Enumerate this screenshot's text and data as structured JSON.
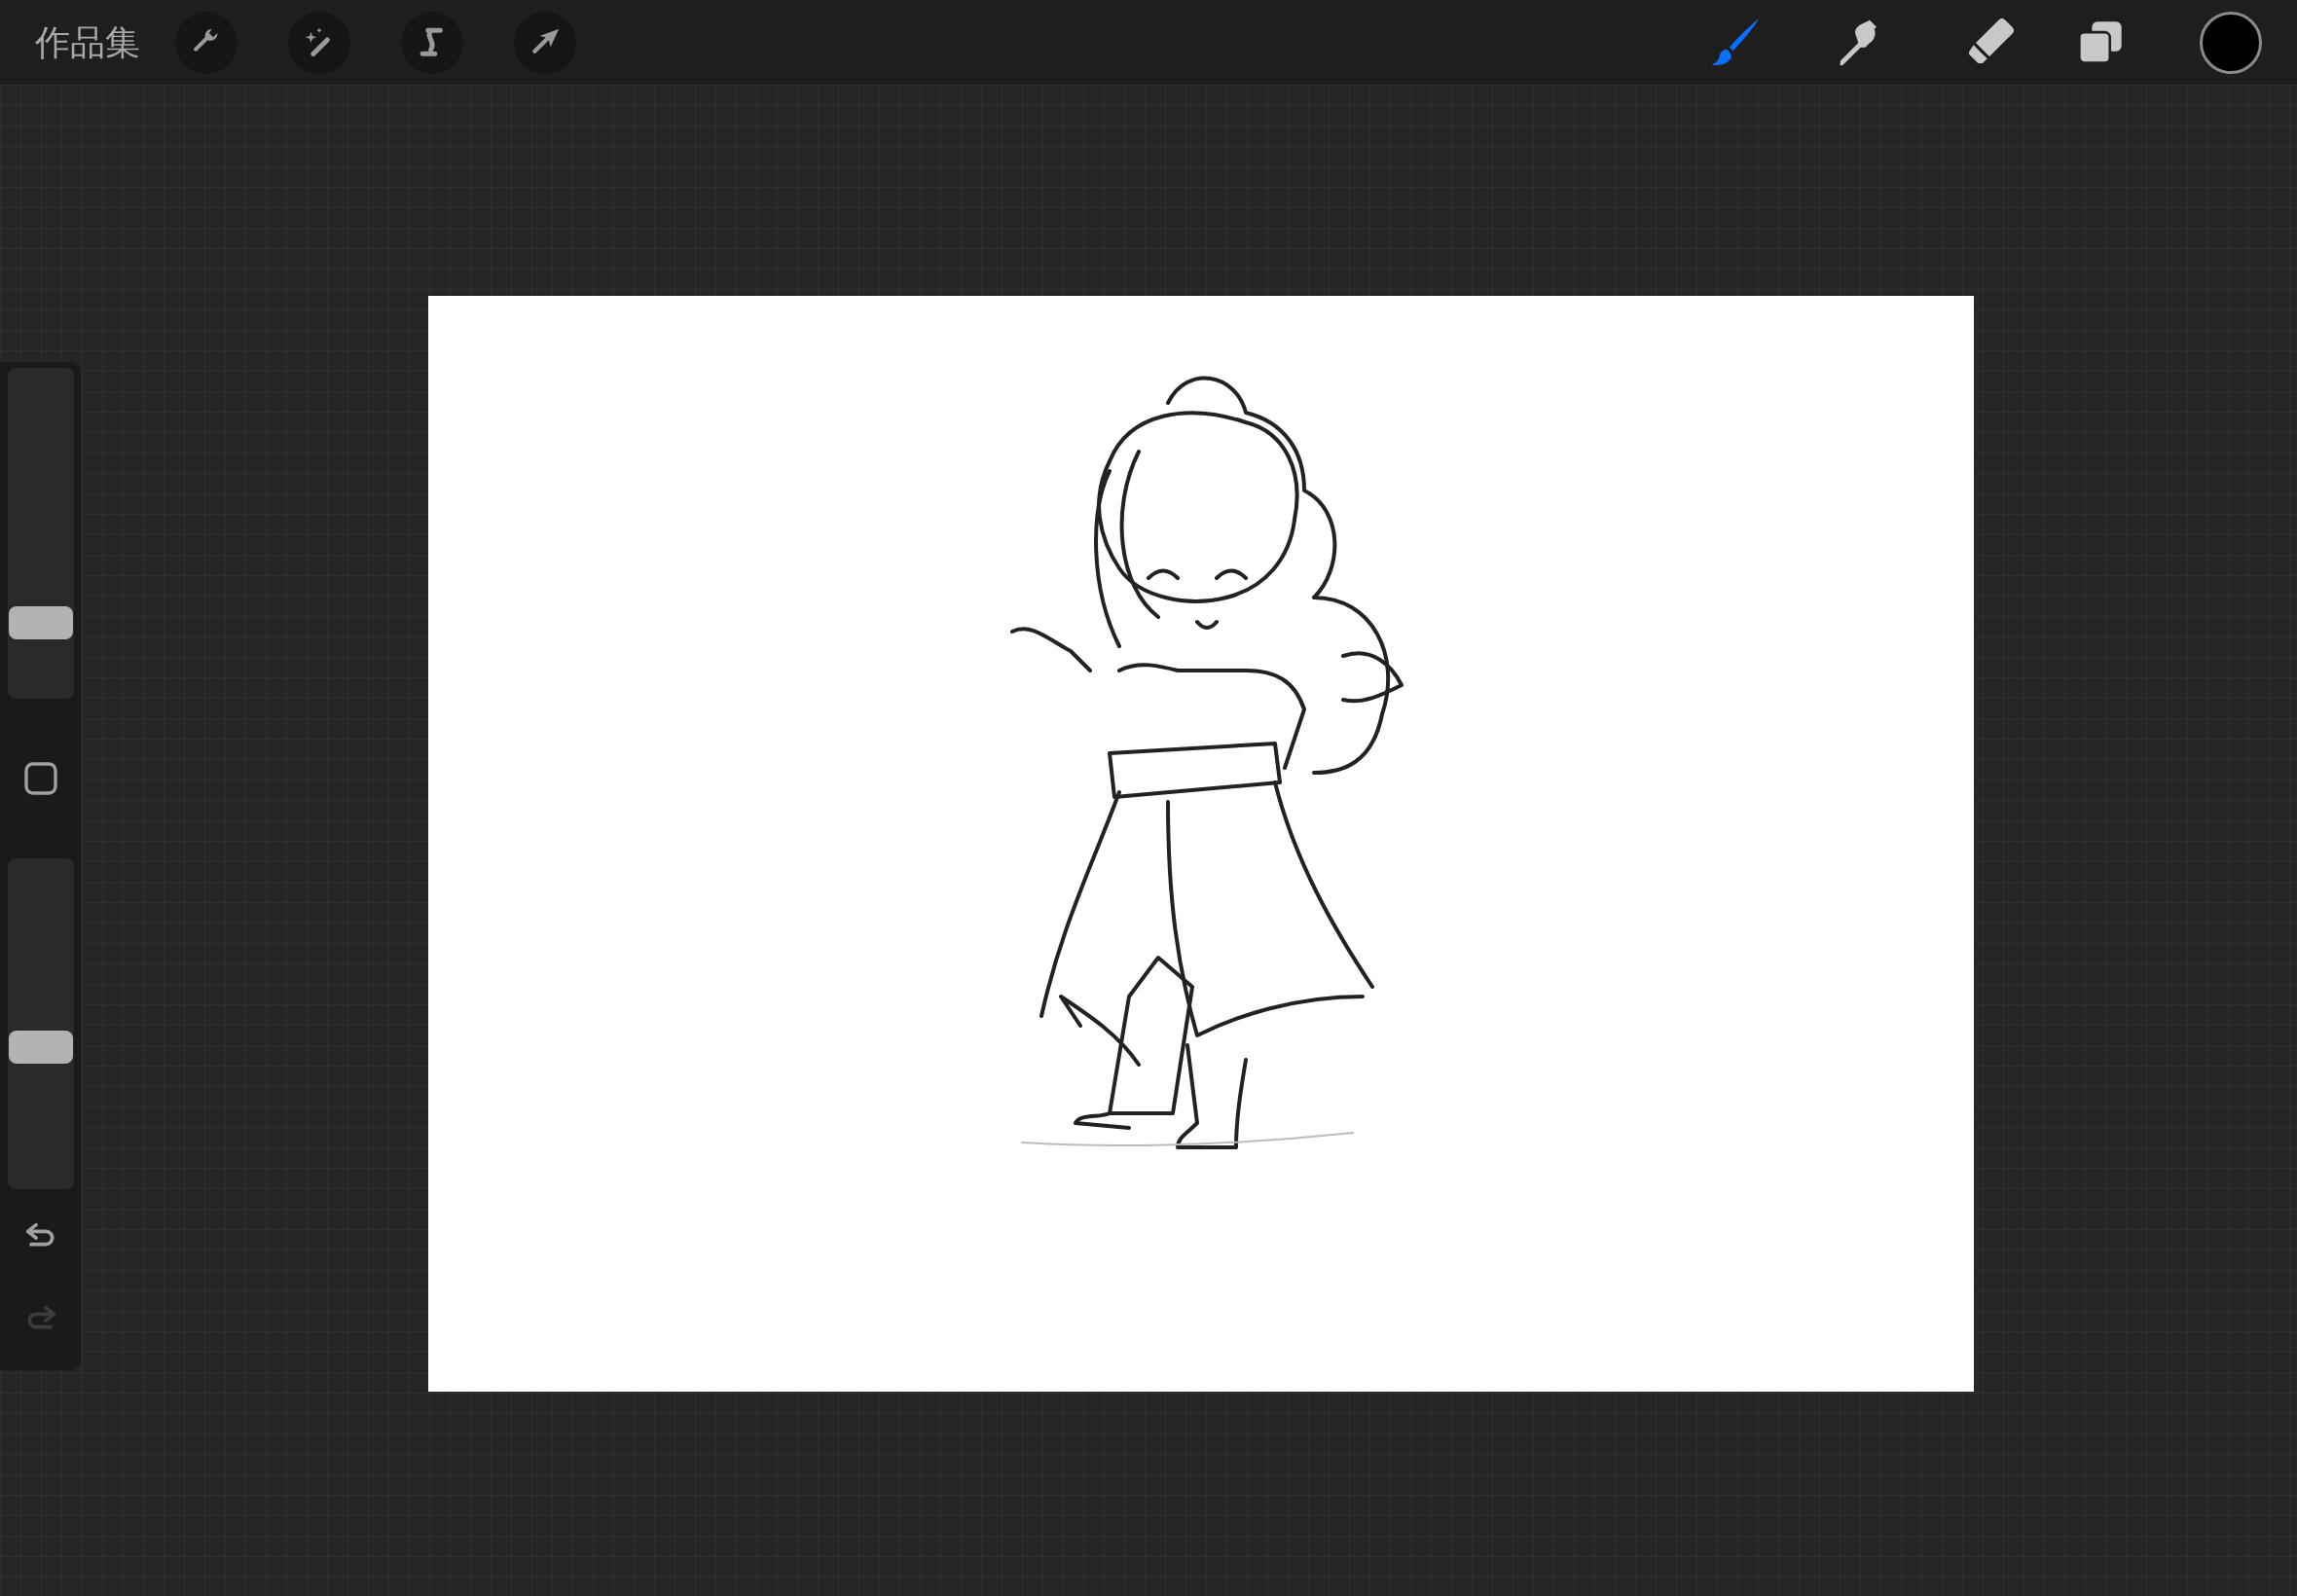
{
  "top_bar": {
    "gallery_label": "作品集",
    "paint_tools": [
      {
        "kind": "brush",
        "selected": true
      },
      {
        "kind": "smudge",
        "selected": false
      },
      {
        "kind": "eraser",
        "selected": false
      }
    ],
    "color_swatch": {
      "color": "#000000"
    }
  },
  "sidebar": {
    "size_slider": {
      "level": 0.2
    },
    "opacity_slider": {
      "level": 0.42
    },
    "undo": {
      "disabled": false
    },
    "redo": {
      "disabled": true
    }
  }
}
